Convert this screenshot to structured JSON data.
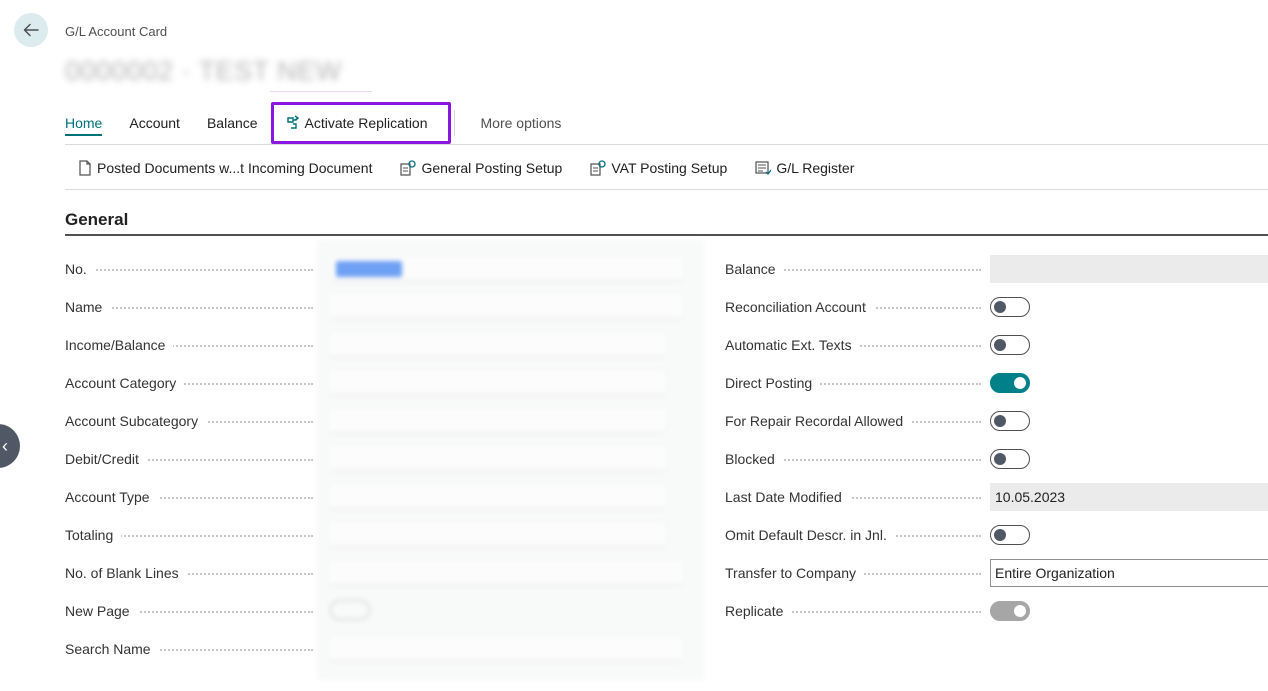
{
  "header": {
    "card_type": "G/L Account Card",
    "title": "0000002 · TEST NEW"
  },
  "tabs": {
    "home": "Home",
    "account": "Account",
    "balance": "Balance",
    "activate_replication": "Activate Replication",
    "more_options": "More options"
  },
  "actions": {
    "posted_documents": "Posted Documents w...t Incoming Document",
    "general_posting_setup": "General Posting Setup",
    "vat_posting_setup": "VAT Posting Setup",
    "gl_register": "G/L Register"
  },
  "section": {
    "title": "General"
  },
  "left_fields": {
    "no": "No.",
    "name": "Name",
    "income_balance": "Income/Balance",
    "account_category": "Account Category",
    "account_subcategory": "Account Subcategory",
    "debit_credit": "Debit/Credit",
    "account_type": "Account Type",
    "totaling": "Totaling",
    "no_of_blank_lines": "No. of Blank Lines",
    "new_page": "New Page",
    "search_name": "Search Name"
  },
  "right_fields": {
    "balance": {
      "label": "Balance",
      "value": ""
    },
    "reconciliation_account": {
      "label": "Reconciliation Account",
      "value": false
    },
    "automatic_ext_texts": {
      "label": "Automatic Ext. Texts",
      "value": false
    },
    "direct_posting": {
      "label": "Direct Posting",
      "value": true
    },
    "for_repair_recordal_allowed": {
      "label": "For Repair Recordal Allowed",
      "value": false
    },
    "blocked": {
      "label": "Blocked",
      "value": false
    },
    "last_date_modified": {
      "label": "Last Date Modified",
      "value": "10.05.2023"
    },
    "omit_default_descr": {
      "label": "Omit Default Descr. in Jnl.",
      "value": false
    },
    "transfer_to_company": {
      "label": "Transfer to Company",
      "value": "Entire Organization"
    },
    "replicate": {
      "label": "Replicate",
      "value": true
    }
  },
  "colors": {
    "accent": "#00707a",
    "toggle_on": "#00818a",
    "highlight_border": "#8a17e0",
    "toggle_disabled": "#a6a6a6"
  },
  "icons": [
    "back-arrow-icon",
    "replication-icon",
    "document-icon",
    "posting-setup-icon",
    "vat-setup-icon",
    "register-icon",
    "chevron-left-icon"
  ]
}
